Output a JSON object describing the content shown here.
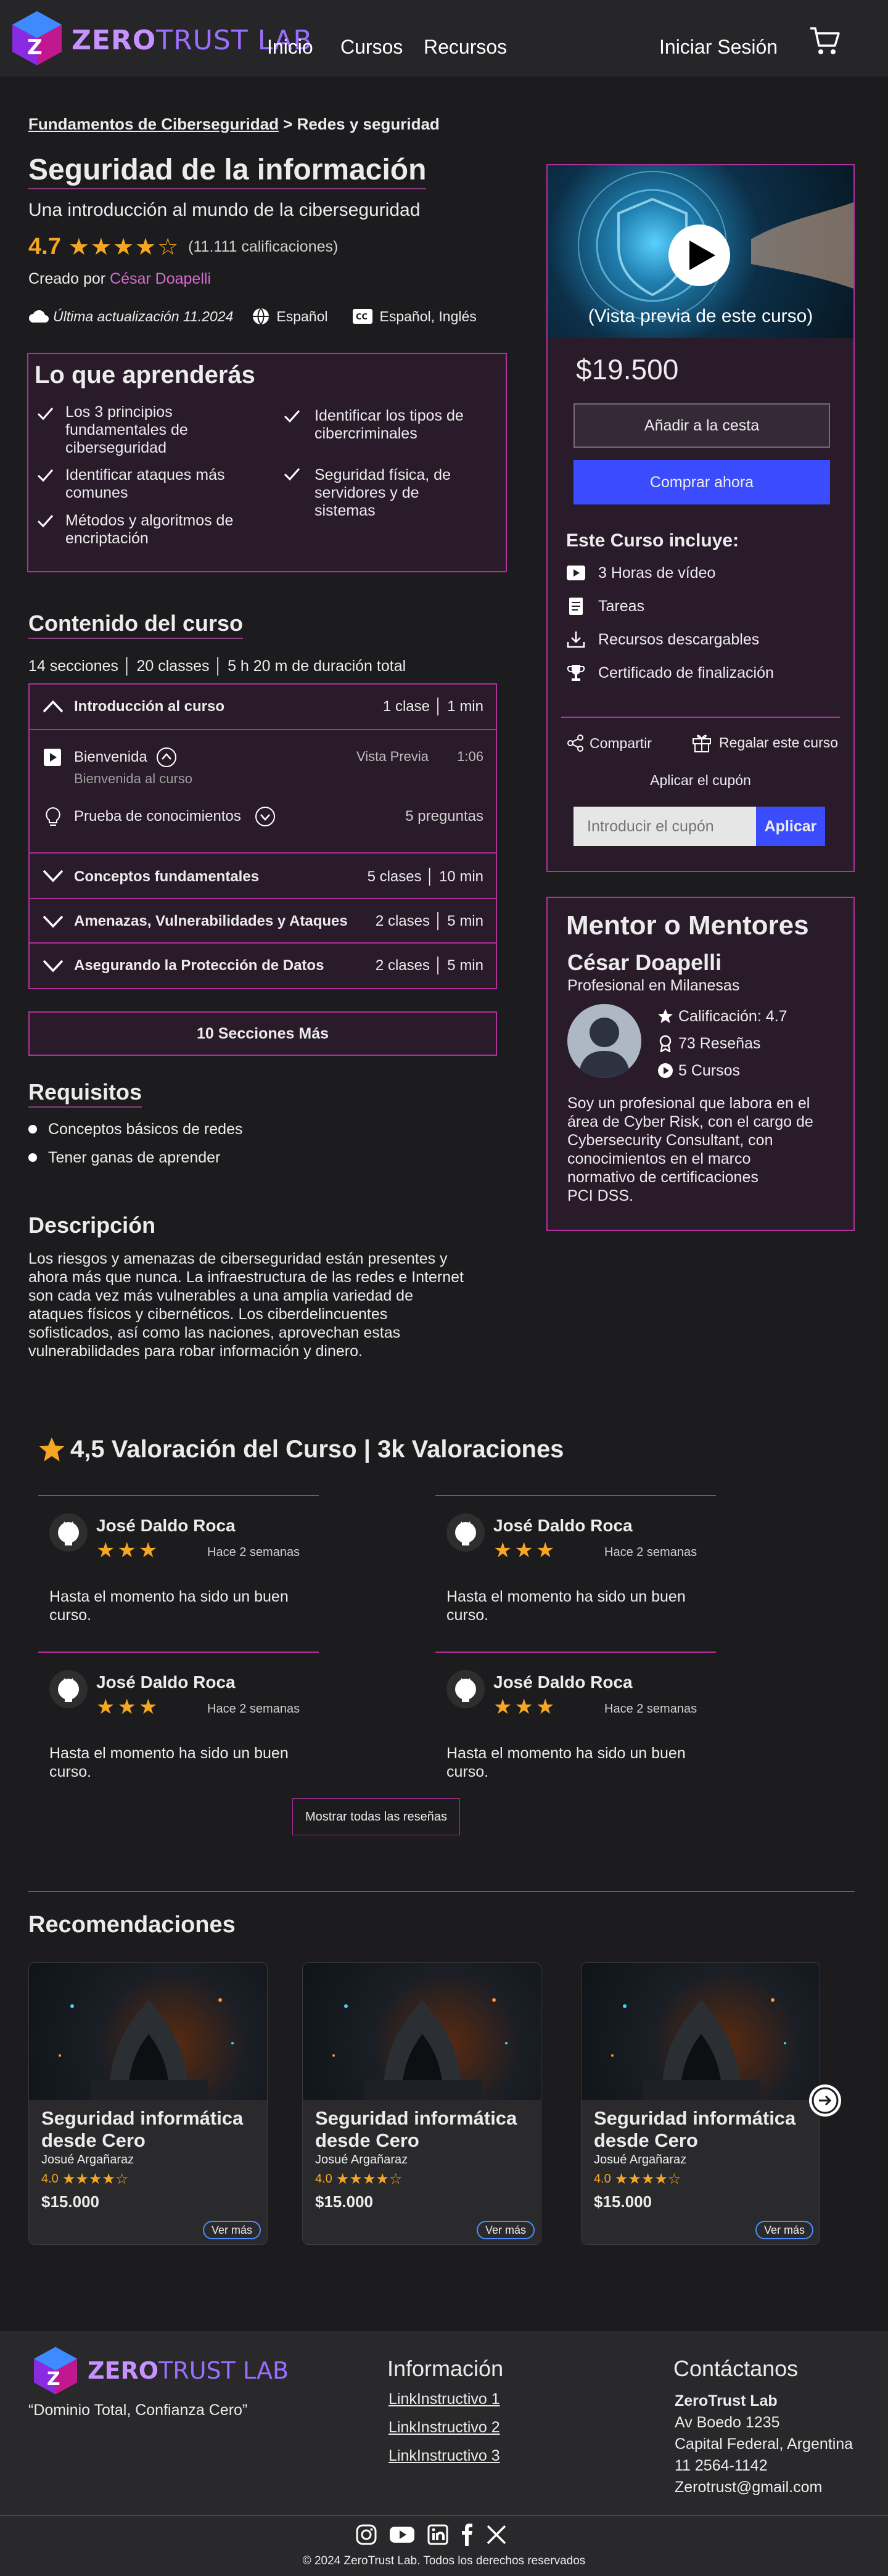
{
  "header": {
    "logo_part1": "ZERO",
    "logo_part2": "TRUST LAB",
    "nav": [
      "Inicio",
      "Cursos",
      "Recursos"
    ],
    "login": "Iniciar Sesión"
  },
  "breadcrumb": {
    "a": "Fundamentos de Ciberseguridad",
    "sep": " > ",
    "b": "Redes y seguridad"
  },
  "course": {
    "title": "Seguridad de la información",
    "subtitle": "Una introducción al mundo de la ciberseguridad",
    "rating": "4.7",
    "rating_value": 4.7,
    "ratings_count": "(11.111 calificaciones)",
    "created_by": "Creado por ",
    "author": "César Doapelli",
    "updated": "Última actualización 11.2024",
    "language": "Español",
    "captions": "Español, Inglés"
  },
  "learn": {
    "title": "Lo que aprenderás",
    "items": [
      "Los 3 principios fundamentales de ciberseguridad",
      "Identificar los tipos de cibercriminales",
      "Identificar ataques más comunes",
      "Seguridad física, de servidores y de sistemas",
      "Métodos y algoritmos de encriptación"
    ]
  },
  "content": {
    "title": "Contenido del curso",
    "summary": "14 secciones │ 20 classes │ 5 h 20 m de duración total",
    "sections": [
      {
        "title": "Introducción al curso",
        "meta": "1 clase │ 1 min"
      },
      {
        "title": "Conceptos fundamentales",
        "meta": "5 clases │ 10 min"
      },
      {
        "title": "Amenazas, Vulnerabilidades y  Ataques",
        "meta": "2 clases │ 5 min"
      },
      {
        "title": "Asegurando la Protección de Datos",
        "meta": "2 clases │ 5 min"
      }
    ],
    "lesson1": {
      "title": "Bienvenida",
      "sub": "Bienvenida al curso",
      "preview": "Vista Previa",
      "duration": "1:06"
    },
    "lesson2": {
      "title": "Prueba de conocimientos",
      "meta": "5 preguntas"
    },
    "more": "10 Secciones Más"
  },
  "requirements": {
    "title": "Requisitos",
    "items": [
      "Conceptos básicos de redes",
      "Tener ganas de aprender"
    ]
  },
  "description": {
    "title": "Descripción",
    "lines": [
      "Los riesgos y amenazas de ciberseguridad están presentes y",
      "ahora más  que nunca. La infraestructura de las redes e Internet",
      "son cada vez más  vulnerables a una amplia variedad de",
      "ataques físicos y cibernéticos. Los ciberdelincuentes",
      "sofisticados, así como las naciones, aprovechan estas",
      "vulnerabilidades para robar información y dinero."
    ]
  },
  "sidebar": {
    "preview_label": "(Vista previa de este curso)",
    "price": "$19.500",
    "add_cart": "Añadir a la cesta",
    "buy_now": "Comprar  ahora",
    "includes_title": "Este Curso incluye:",
    "includes": [
      "3 Horas de vídeo",
      "Tareas",
      "Recursos descargables",
      "Certificado  de finalización"
    ],
    "share": "Compartir",
    "gift": "Regalar este curso",
    "coupon_link": "Aplicar el cupón",
    "coupon_placeholder": "Introducir el cupón",
    "coupon_apply": "Aplicar"
  },
  "mentor": {
    "title": "Mentor o Mentores",
    "name": "César Doapelli",
    "role": "Profesional en Milanesas",
    "rating": "Calificación: 4.7",
    "reviews": "73 Reseñas",
    "courses": "5 Cursos",
    "bio": [
      "Soy un profesional que labora en el",
      "área de Cyber Risk, con el cargo de",
      "Cybersecurity Consultant, con",
      "conocimientos en el marco",
      "normativo de  certificaciones",
      "PCI DSS."
    ]
  },
  "reviews": {
    "title": "4,5 Valoración del Curso | 3k  Valoraciones",
    "items": [
      {
        "name": "José Daldo Roca",
        "when": "Hace 2 semanas",
        "text1": "Hasta el momento ha sido un buen",
        "text2": "curso.",
        "stars": 3
      },
      {
        "name": "José Daldo Roca",
        "when": "Hace 2 semanas",
        "text1": "Hasta el momento ha sido un buen",
        "text2": "curso.",
        "stars": 3
      },
      {
        "name": "José Daldo Roca",
        "when": "Hace 2 semanas",
        "text1": "Hasta el momento ha sido un buen",
        "text2": "curso.",
        "stars": 3
      },
      {
        "name": "José Daldo Roca",
        "when": "Hace 2 semanas",
        "text1": "Hasta el momento ha sido un buen",
        "text2": "curso.",
        "stars": 3
      }
    ],
    "show_all": "Mostrar todas las reseñas"
  },
  "recommendations": {
    "title": "Recomendaciones",
    "cards": [
      {
        "title1": "Seguridad informática",
        "title2": "desde Cero",
        "author": "Josué Argañaraz",
        "rating": "4.0",
        "rating_value": 4,
        "price": "$15.000",
        "cta": "Ver más"
      },
      {
        "title1": "Seguridad informática",
        "title2": "desde Cero",
        "author": "Josué Argañaraz",
        "rating": "4.0",
        "rating_value": 4,
        "price": "$15.000",
        "cta": "Ver más"
      },
      {
        "title1": "Seguridad informática",
        "title2": "desde Cero",
        "author": "Josué Argañaraz",
        "rating": "4.0",
        "rating_value": 4,
        "price": "$15.000",
        "cta": "Ver más"
      }
    ]
  },
  "footer": {
    "slogan": "“Dominio Total, Confianza Cero”",
    "info_title": "Información",
    "links": [
      "LinkInstructivo 1",
      "LinkInstructivo 2",
      "LinkInstructivo 3"
    ],
    "contact_title": "Contáctanos",
    "company": "ZeroTrust Lab",
    "address1": "Av Boedo 1235",
    "address2": "Capital Federal, Argentina",
    "phone": "11 2564-1142",
    "email": "Zerotrust@gmail.com",
    "copyright": "© 2024 ZeroTrust Lab. Todos los derechos reservados"
  },
  "colors": {
    "accent": "#b0309f",
    "brand_blue": "#3b4cff",
    "star": "#f5a623",
    "bg": "#1c1b1d",
    "card": "#2a1b2a"
  }
}
